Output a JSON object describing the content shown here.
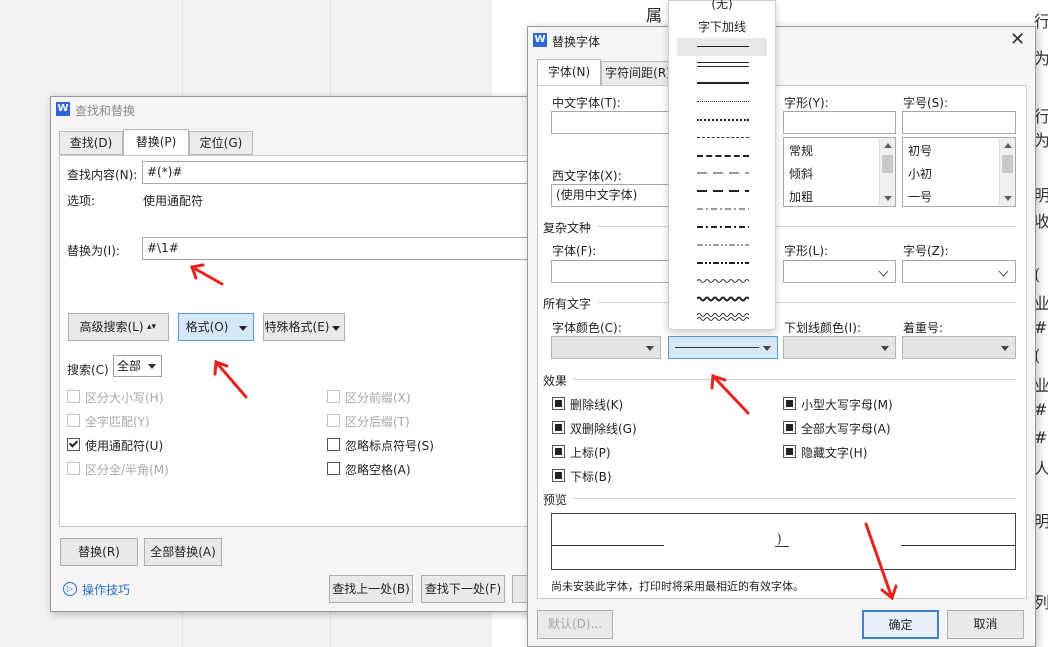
{
  "background_doc": {
    "top_text": "属 # ;",
    "right_chars": [
      "行",
      "为",
      "行",
      "为",
      "明",
      "收",
      "(",
      "业",
      "#",
      "(",
      "业",
      "#",
      "#",
      "人",
      "明",
      "列"
    ]
  },
  "find_dialog": {
    "title": "查找和替换",
    "tabs": [
      "查找(D)",
      "替换(P)",
      "定位(G)"
    ],
    "find_label": "查找内容(N):",
    "find_value": "#(*)#",
    "options_label": "选项:",
    "options_value": "使用通配符",
    "replace_label": "替换为(I):",
    "replace_value": "#\\1#",
    "advanced_btn": "高级搜索(L)",
    "format_btn": "格式(O)",
    "special_btn": "特殊格式(E)",
    "search_label": "搜索(C)",
    "search_value": "全部",
    "checks": {
      "match_case": "区分大小写(H)",
      "whole_word": "全字匹配(Y)",
      "wildcard": "使用通配符(U)",
      "half_full": "区分全/半角(M)",
      "prefix": "区分前缀(X)",
      "suffix": "区分后缀(T)",
      "ignore_punct": "忽略标点符号(S)",
      "ignore_space": "忽略空格(A)"
    },
    "replace_btn": "替换(R)",
    "replace_all_btn": "全部替换(A)",
    "tips_link": "操作技巧",
    "find_prev_btn": "查找上一处(B)",
    "find_next_btn": "查找下一处(F)"
  },
  "font_dialog": {
    "title": "替换字体",
    "tabs": [
      "字体(N)",
      "字符间距(R)"
    ],
    "cn_font_label": "中文字体(T):",
    "west_font_label": "西文字体(X):",
    "west_font_value": "(使用中文字体)",
    "style_label": "字形(Y):",
    "style_items": [
      "常规",
      "倾斜",
      "加粗"
    ],
    "size_label": "字号(S):",
    "size_items": [
      "初号",
      "小初",
      "一号"
    ],
    "complex_section": "复杂文种",
    "complex_font_label": "字体(F):",
    "complex_style_label": "字形(L):",
    "complex_size_label": "字号(Z):",
    "all_text_section": "所有文字",
    "font_color_label": "字体颜色(C):",
    "underline_color_label": "下划线颜色(I):",
    "emphasis_label": "着重号:",
    "effects_section": "效果",
    "effects": [
      "删除线(K)",
      "双删除线(G)",
      "上标(P)",
      "下标(B)",
      "小型大写字母(M)",
      "全部大写字母(A)",
      "隐藏文字(H)"
    ],
    "preview_section": "预览",
    "preview_char": ")",
    "note": "尚未安装此字体，打印时将采用最相近的有效字体。",
    "default_btn": "默认(D)...",
    "ok_btn": "确定",
    "cancel_btn": "取消"
  },
  "underline_dropdown": {
    "items": [
      "(无)",
      "字下加线"
    ]
  },
  "colors": {
    "accent": "#2f66d6",
    "highlight": "#d5e8f8",
    "arrow": "#e8221c",
    "link": "#2c6ec9"
  }
}
